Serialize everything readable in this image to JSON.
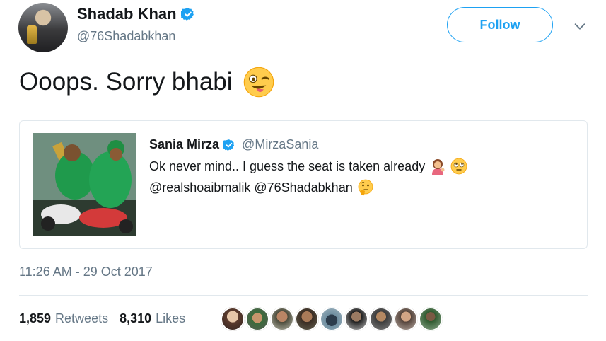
{
  "author": {
    "display_name": "Shadab Khan",
    "handle": "@76Shadabkhan"
  },
  "actions": {
    "follow_label": "Follow"
  },
  "tweet": {
    "text": "Ooops. Sorry bhabi",
    "timestamp": "11:26 AM - 29 Oct 2017"
  },
  "quoted_tweet": {
    "display_name": "Sania Mirza",
    "handle": "@MirzaSania",
    "line1": "Ok never mind.. I guess the seat is taken already",
    "line2": "@realshoaibmalik @76Shadabkhan"
  },
  "stats": {
    "retweets_count": "1,859",
    "retweets_label": "Retweets",
    "likes_count": "8,310",
    "likes_label": "Likes"
  },
  "icons": {
    "verified": "verified-badge-icon",
    "chevron": "chevron-down-icon",
    "tweet_emoji": "winking-face-with-tongue-emoji",
    "quote_emoji_1": "woman-tipping-hand-emoji",
    "quote_emoji_2": "face-with-rolling-eyes-emoji",
    "quote_emoji_3": "thinking-face-emoji"
  },
  "colors": {
    "accent": "#1da1f2",
    "secondary_text": "#657786",
    "border": "#e1e8ed"
  }
}
